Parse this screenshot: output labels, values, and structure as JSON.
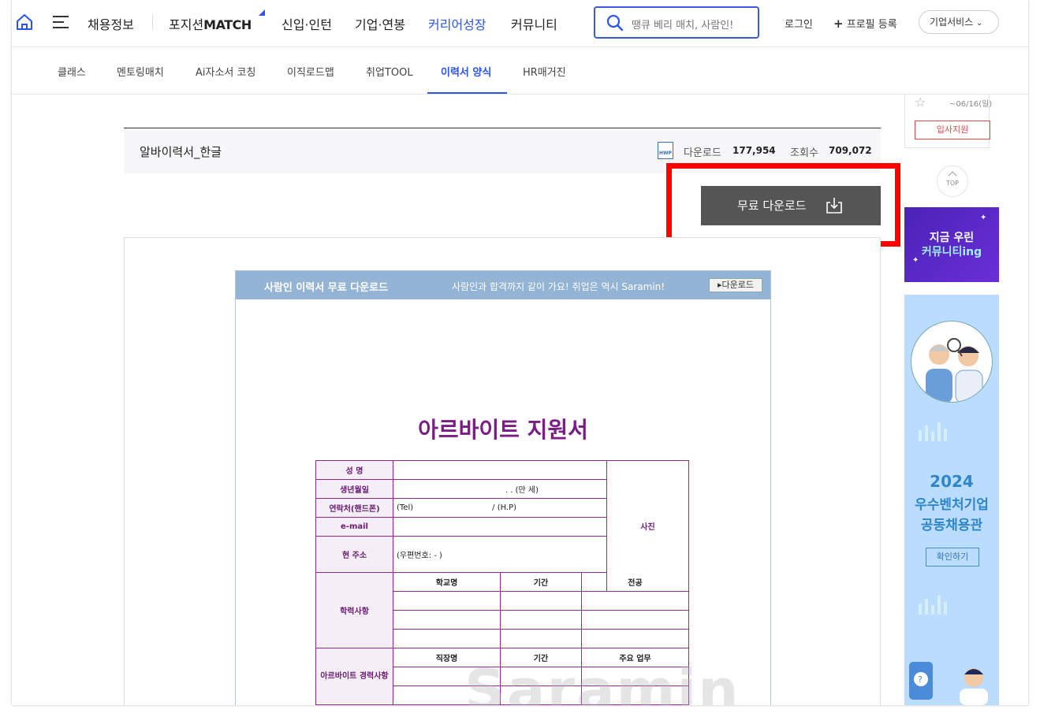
{
  "gnb": {
    "nav": [
      "채용정보",
      "포지션",
      "MATCH",
      "신입·인턴",
      "기업·연봉",
      "커리어성장",
      "커뮤니티"
    ],
    "active": "커리어성장",
    "search_placeholder": "땡큐 베리 매치, 사람인!",
    "login": "로그인",
    "profile": "프로필 등록",
    "business": "기업서비스"
  },
  "lnb": {
    "items": [
      "클래스",
      "멘토링매치",
      "Ai자소서 코칭",
      "이직로드맵",
      "취업TOOL",
      "이력서 양식",
      "HR매거진"
    ],
    "active": "이력서 양식"
  },
  "item": {
    "title": "알바이력서_한글",
    "file_type": "HWP",
    "download_label": "다운로드",
    "download_count": "177,954",
    "view_label": "조회수",
    "view_count": "709,072",
    "download_button": "무료 다운로드"
  },
  "preview": {
    "header_title": "사람인 이력서 무료 다운로드",
    "header_slogan": "사람인과 합격까지 같이 가요! 취업은 역시 Saramin!",
    "header_button": "▸다운로드",
    "doc_title": "아르바이트 지원서",
    "labels": {
      "name": "성 명",
      "birth": "생년월일",
      "birth_value": ".   .   (만   세)",
      "contact": "연락처(핸드폰)",
      "tel": "(Tel)",
      "hp": "/ (H.P)",
      "email": "e-mail",
      "address": "현 주소",
      "zip": "(우편번호:      -      )",
      "photo": "사진",
      "education": "학력사항",
      "school": "학교명",
      "period": "기간",
      "major": "전공",
      "career": "아르바이트 경력사항",
      "company": "직장명",
      "duty": "주요 업무"
    },
    "watermark": "Saramin"
  },
  "side": {
    "date": "~06/16(일)",
    "apply": "입사지원",
    "top": "TOP",
    "banner1_line1": "지금 우린",
    "banner1_line2": "커뮤니티ing",
    "banner2_year": "2024",
    "banner2_line1": "우수벤처기업",
    "banner2_line2": "공동채용관",
    "banner2_button": "확인하기"
  }
}
